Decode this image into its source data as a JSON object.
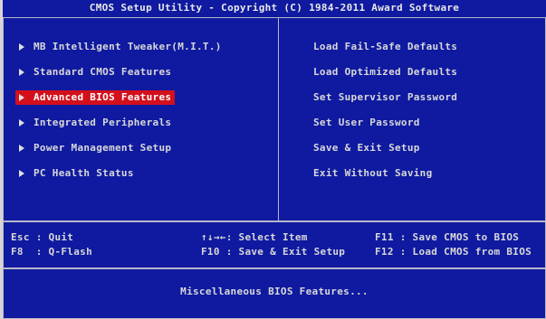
{
  "title": "CMOS Setup Utility - Copyright (C) 1984-2011 Award Software",
  "left_menu": [
    {
      "label": "MB Intelligent Tweaker(M.I.T.)",
      "selected": false
    },
    {
      "label": "Standard CMOS Features",
      "selected": false
    },
    {
      "label": "Advanced BIOS Features",
      "selected": true
    },
    {
      "label": "Integrated Peripherals",
      "selected": false
    },
    {
      "label": "Power Management Setup",
      "selected": false
    },
    {
      "label": "PC Health Status",
      "selected": false
    }
  ],
  "right_menu": [
    {
      "label": "Load Fail-Safe Defaults"
    },
    {
      "label": "Load Optimized Defaults"
    },
    {
      "label": "Set Supervisor Password"
    },
    {
      "label": "Set User Password"
    },
    {
      "label": "Save & Exit Setup"
    },
    {
      "label": "Exit Without Saving"
    }
  ],
  "help": {
    "esc": "Esc : Quit",
    "f8": "F8  : Q-Flash",
    "arrows": "↑↓→←: Select Item",
    "f10": "F10 : Save & Exit Setup",
    "f11": "F11 : Save CMOS to BIOS",
    "f12": "F12 : Load CMOS from BIOS"
  },
  "status": "Miscellaneous BIOS Features...",
  "colors": {
    "background": "#0f1aa0",
    "highlight": "#d40f1c",
    "text": "#d8d8d8"
  }
}
